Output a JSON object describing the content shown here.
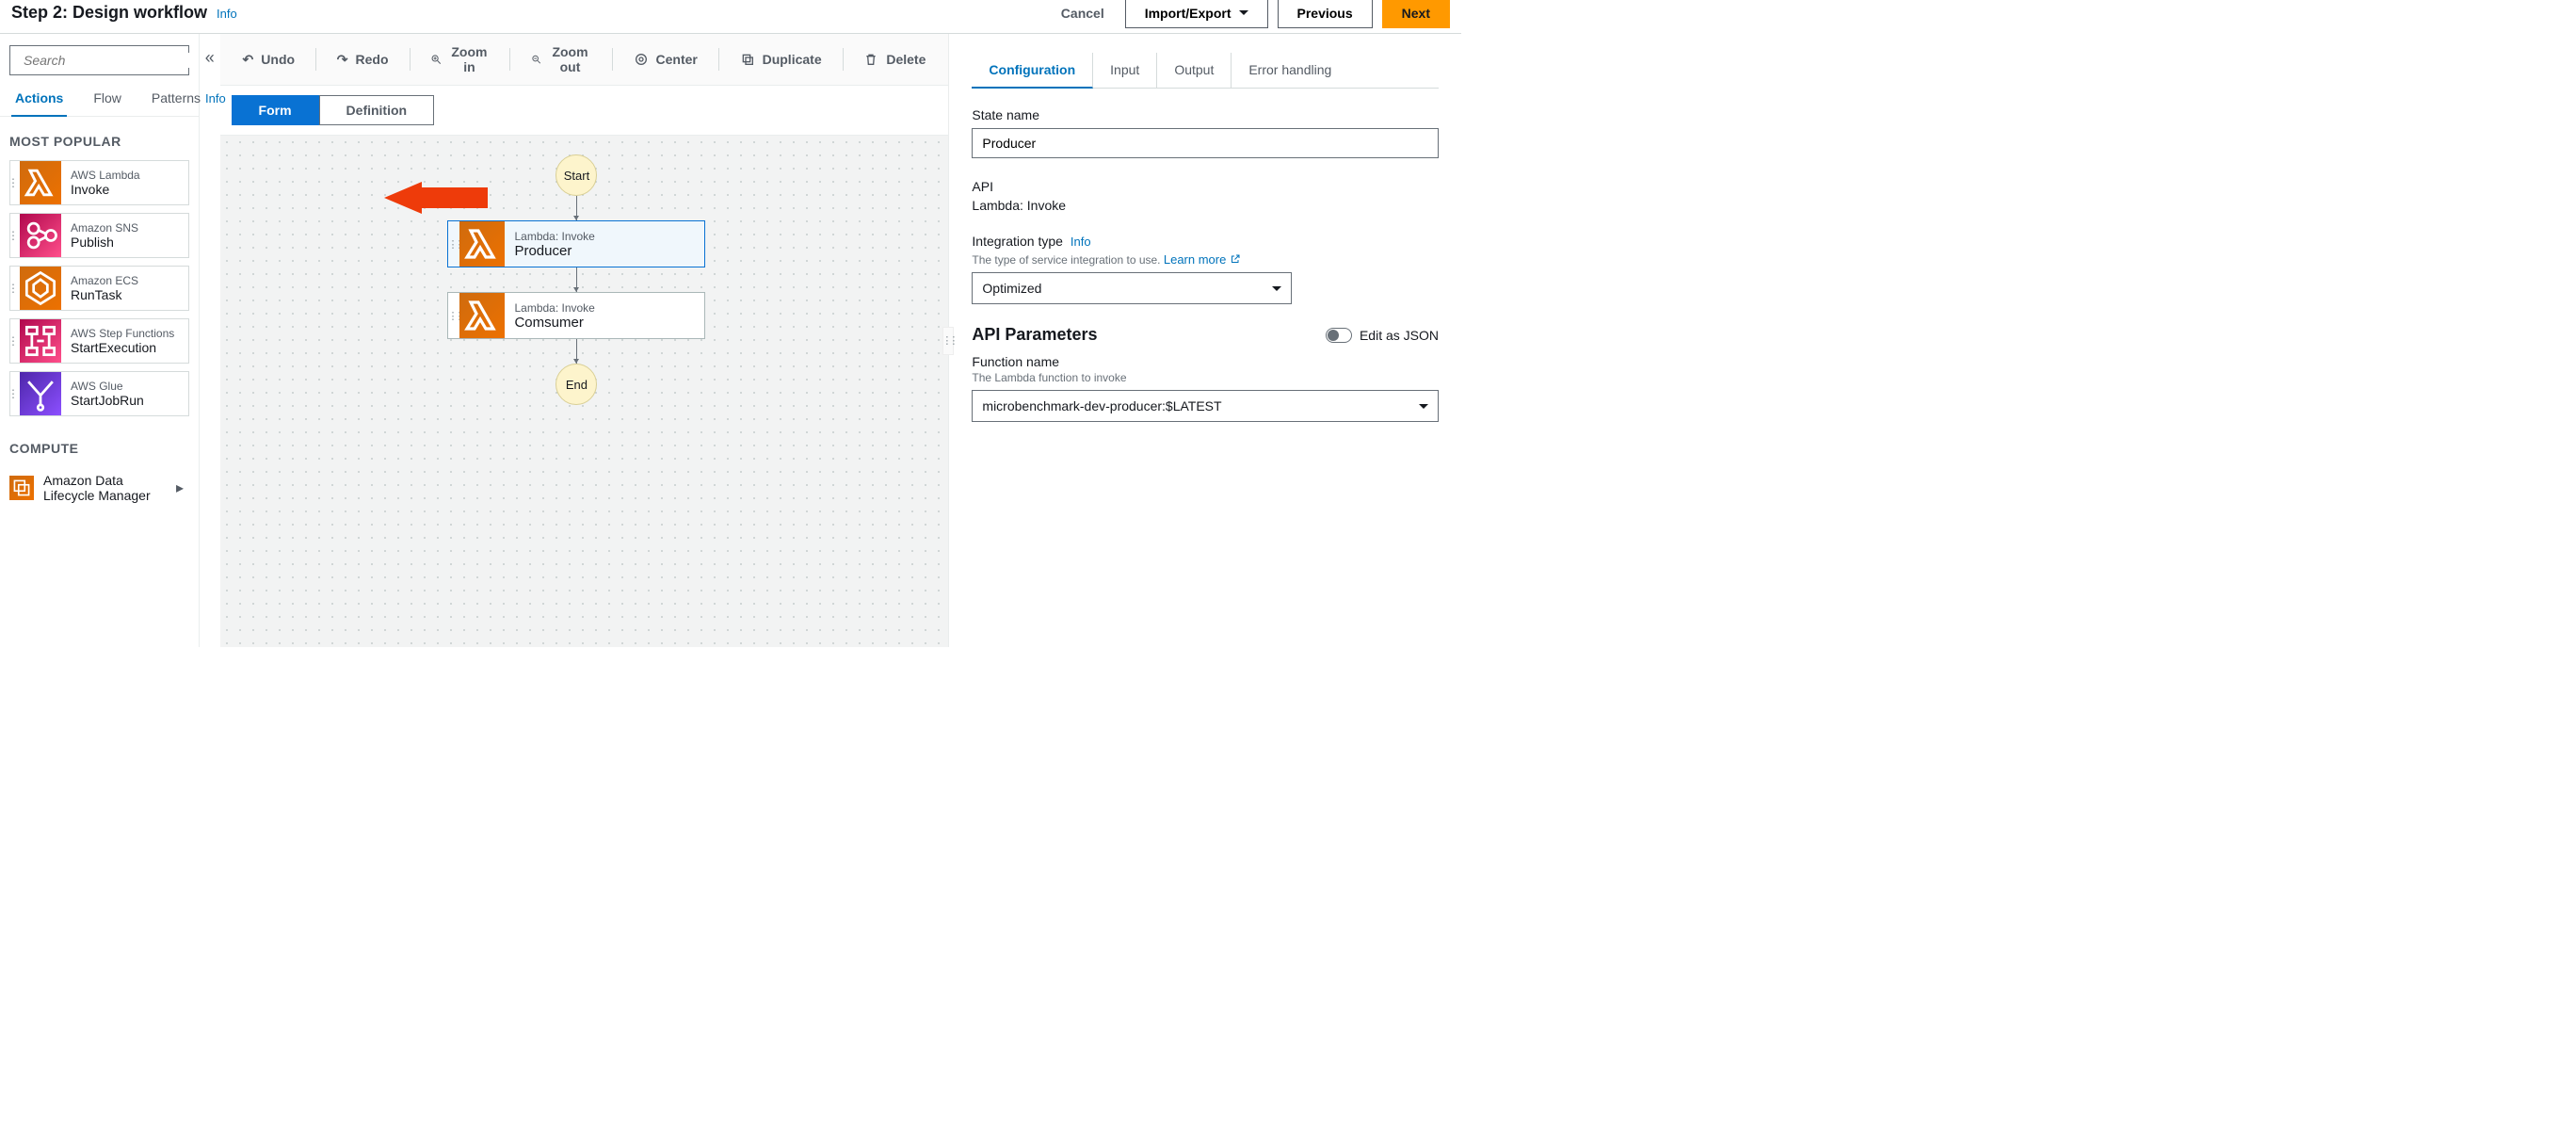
{
  "header": {
    "title": "Step 2: Design workflow",
    "info": "Info",
    "cancel": "Cancel",
    "import_export": "Import/Export",
    "previous": "Previous",
    "next": "Next"
  },
  "sidebar": {
    "search_placeholder": "Search",
    "tabs": {
      "actions": "Actions",
      "flow": "Flow",
      "patterns": "Patterns",
      "patterns_info": "Info"
    },
    "most_popular_label": "MOST POPULAR",
    "compute_label": "COMPUTE",
    "items": [
      {
        "service": "AWS Lambda",
        "name": "Invoke"
      },
      {
        "service": "Amazon SNS",
        "name": "Publish"
      },
      {
        "service": "Amazon ECS",
        "name": "RunTask"
      },
      {
        "service": "AWS Step Functions",
        "name": "StartExecution"
      },
      {
        "service": "AWS Glue",
        "name": "StartJobRun"
      }
    ],
    "compute_item": "Amazon Data Lifecycle Manager"
  },
  "toolbar": {
    "undo": "Undo",
    "redo": "Redo",
    "zoom_in": "Zoom in",
    "zoom_out": "Zoom out",
    "center": "Center",
    "duplicate": "Duplicate",
    "delete": "Delete"
  },
  "view_tabs": {
    "form": "Form",
    "definition": "Definition"
  },
  "flow": {
    "start": "Start",
    "end": "End",
    "nodes": [
      {
        "sub": "Lambda: Invoke",
        "title": "Producer"
      },
      {
        "sub": "Lambda: Invoke",
        "title": "Comsumer"
      }
    ]
  },
  "config": {
    "tabs": {
      "configuration": "Configuration",
      "input": "Input",
      "output": "Output",
      "error": "Error handling"
    },
    "state_name_label": "State name",
    "state_name_value": "Producer",
    "api_label": "API",
    "api_value": "Lambda: Invoke",
    "integration_label": "Integration type",
    "integration_info": "Info",
    "integration_help": "The type of service integration to use.",
    "learn_more": "Learn more",
    "integration_value": "Optimized",
    "params_heading": "API Parameters",
    "edit_json": "Edit as JSON",
    "function_label": "Function name",
    "function_help": "The Lambda function to invoke",
    "function_value": "microbenchmark-dev-producer:$LATEST"
  }
}
